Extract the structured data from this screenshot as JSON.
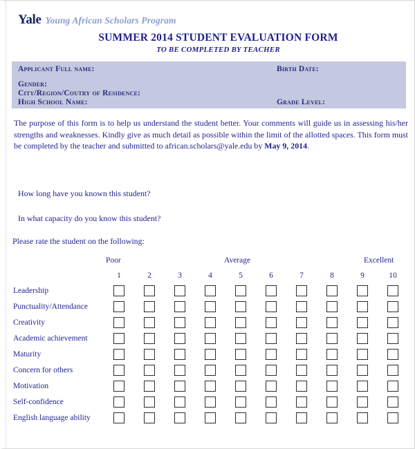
{
  "header": {
    "brand": "Yale",
    "program": "Young African Scholars Program"
  },
  "title": "SUMMER 2014 STUDENT EVALUATION FORM",
  "subtitle": "TO BE COMPLETED BY TEACHER",
  "applicant_block": {
    "fullname_label": "Applicant Full name:",
    "birthdate_label": "Birth Date:",
    "gender_label": "Gender:",
    "city_label": "City/Region/Coutry of Residence:",
    "school_label": "High School Name:",
    "gradelevel_label": "Grade Level:"
  },
  "purpose": {
    "text": "The purpose of this form is to help us understand the student better. Your comments will guide us in assessing his/her strengths and weaknesses. Kindly give as much detail as possible within the limit of the allotted spaces. This form must be completed by the teacher and submitted to african.scholars@yale.edu by ",
    "deadline": "May 9, 2014",
    "tail": "."
  },
  "questions": {
    "q1": "How long have you known this student?",
    "q2": "In what capacity do you know this student?",
    "q3": "Please rate the student on the following:"
  },
  "rating": {
    "scale_low": "Poor",
    "scale_mid": "Average",
    "scale_high": "Excellent",
    "numbers": [
      "1",
      "2",
      "3",
      "4",
      "5",
      "6",
      "7",
      "8",
      "9",
      "10"
    ],
    "criteria": [
      "Leadership",
      "Punctuality/Attendance",
      "Creativity",
      "Academic achievement",
      "Maturity",
      "Concern for others",
      "Motivation",
      "Self-confidence",
      "English language ability"
    ]
  },
  "colors": {
    "text_navy": "#1f1f8f",
    "brand_navy": "#14215e",
    "program_blue": "#8c9ec9",
    "block_shade": "#c3c9e0",
    "checkbox_border": "#2b2b2b"
  }
}
